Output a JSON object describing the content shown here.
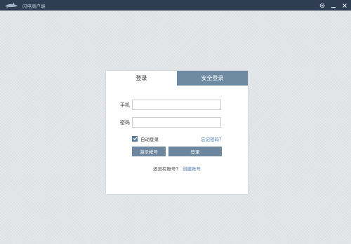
{
  "window": {
    "title": "闪电商户端",
    "controls": [
      "gear-icon",
      "minimize-icon",
      "close-icon"
    ]
  },
  "login": {
    "tabs": [
      {
        "label": "登录",
        "active": true
      },
      {
        "label": "安全登录",
        "active": false
      }
    ],
    "phone_label": "手机",
    "phone_value": "",
    "password_label": "密码",
    "password_value": "",
    "auto_login_label": "自动登录",
    "auto_login_checked": true,
    "forgot_link": "忘记密码？",
    "demo_button": "演示帐号",
    "login_button": "登录",
    "register_prompt": "还没有账号？",
    "register_link": "创建账号"
  },
  "colors": {
    "titlebar": "#2e3d52",
    "accent": "#6f8aa3",
    "button": "#6c879f",
    "link": "#4d7fb0",
    "background": "#e2e5e8"
  }
}
